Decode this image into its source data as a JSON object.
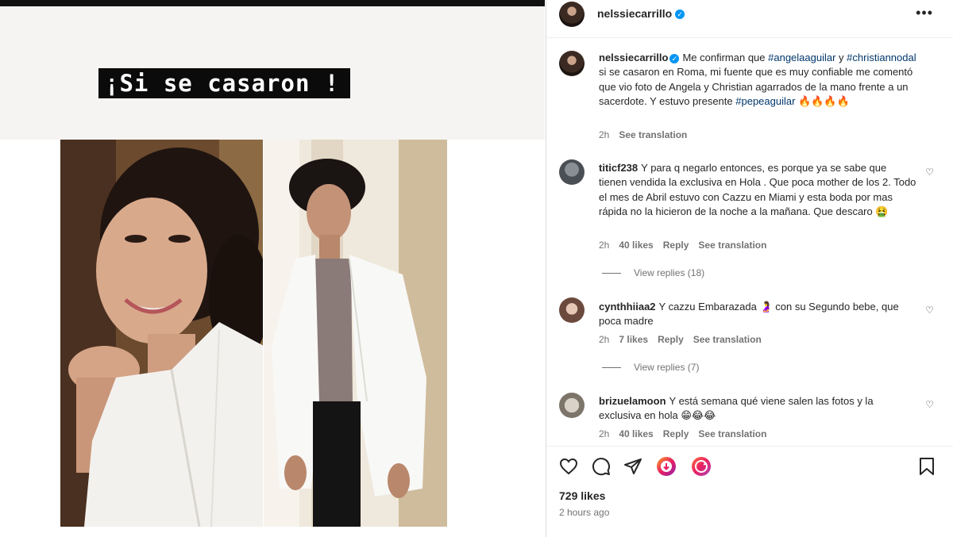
{
  "media": {
    "story_caption": "¡Si se casaron !"
  },
  "header": {
    "username": "nelssiecarrillo",
    "verified_glyph": "✓",
    "more_glyph": "•••"
  },
  "caption": {
    "username": "nelssiecarrillo",
    "text_1": "Me confirman que ",
    "hashtag_1": "#angelaaguilar",
    "text_2": " y ",
    "hashtag_2": "#christiannodal",
    "text_3": " si se casaron en Roma, mi fuente que es muy confiable me comentó que vio foto de Angela y Christian agarrados de la mano frente a un sacerdote. Y estuvo presente ",
    "hashtag_3": "#pepeaguilar",
    "emojis": "🔥🔥🔥🔥",
    "time": "2h",
    "see_translation": "See translation"
  },
  "comments": [
    {
      "username": "titicf238",
      "text": "Y para q negarlo entonces, es porque ya se sabe que tienen vendida la exclusiva en Hola . Que poca mother de los 2. Todo el mes de Abril estuvo con Cazzu en Miami y esta boda por mas rápida no la hicieron de la noche a la mañana. Que descaro 🤮",
      "time": "2h",
      "likes": "40 likes",
      "reply": "Reply",
      "see_translation": "See translation",
      "view_replies": "View replies (18)"
    },
    {
      "username": "cynthhiiaa2",
      "text": "Y cazzu Embarazada 🤰 con su Segundo bebe, que poca madre",
      "time": "2h",
      "likes": "7 likes",
      "reply": "Reply",
      "see_translation": "See translation",
      "view_replies": "View replies (7)"
    },
    {
      "username": "brizuelamoon",
      "text": "Y está semana qué viene salen las fotos y la exclusiva en hola 😁😂😂",
      "time": "2h",
      "likes": "40 likes",
      "reply": "Reply",
      "see_translation": "See translation"
    }
  ],
  "footer": {
    "likes": "729 likes",
    "time_ago": "2 hours ago"
  },
  "icons": {
    "heart": "heart-icon",
    "comment": "comment-icon",
    "share": "share-icon",
    "bookmark": "bookmark-icon"
  },
  "colors": {
    "link": "#00376b",
    "verified": "#0095f6",
    "muted": "#737373",
    "text": "#262626"
  }
}
